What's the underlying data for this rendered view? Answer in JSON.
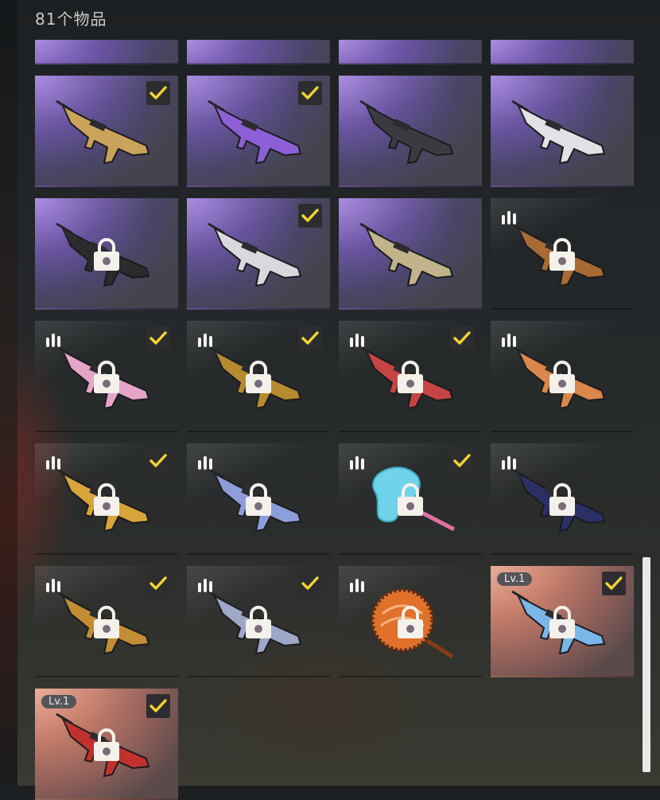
{
  "header": {
    "count_label": "81个物品"
  },
  "colors": {
    "epic": "#6a55a3",
    "legendary": "#a870bc",
    "mythic": "#c87e6b",
    "check": "#f3d431"
  },
  "items": [
    {
      "name": "item-r1c1",
      "rarity": "epic",
      "checked": true,
      "locked": false,
      "icon": "compact-rifle-icon"
    },
    {
      "name": "item-r1c2",
      "rarity": "epic",
      "checked": true,
      "locked": false,
      "icon": "smg-purple-icon"
    },
    {
      "name": "item-r1c3",
      "rarity": "epic",
      "checked": false,
      "locked": false,
      "icon": "rifle-dark-icon"
    },
    {
      "name": "item-r1c4",
      "rarity": "epic",
      "checked": false,
      "locked": false,
      "icon": "rifle-white-icon"
    },
    {
      "name": "item-r2c1",
      "rarity": "epic",
      "checked": false,
      "locked": true,
      "icon": "rifle-black-icon"
    },
    {
      "name": "item-r2c2",
      "rarity": "epic",
      "checked": true,
      "locked": false,
      "icon": "rifle-silver-icon"
    },
    {
      "name": "item-r2c3",
      "rarity": "epic",
      "checked": false,
      "locked": false,
      "icon": "rifle-camo-icon"
    },
    {
      "name": "item-r2c4",
      "rarity": "legendary",
      "checked": false,
      "locked": true,
      "icon": "rifle-bronze-icon"
    },
    {
      "name": "item-r3c1",
      "rarity": "legendary",
      "checked": true,
      "locked": true,
      "icon": "rifle-pink-icon"
    },
    {
      "name": "item-r3c2",
      "rarity": "legendary",
      "checked": true,
      "locked": true,
      "icon": "lmg-gold-icon"
    },
    {
      "name": "item-r3c3",
      "rarity": "legendary",
      "checked": true,
      "locked": true,
      "icon": "rifle-red-icon"
    },
    {
      "name": "item-r3c4",
      "rarity": "legendary",
      "checked": false,
      "locked": true,
      "icon": "rifle-multicolor-icon"
    },
    {
      "name": "item-r4c1",
      "rarity": "legendary",
      "checked": true,
      "locked": true,
      "icon": "rifle-gold-icon"
    },
    {
      "name": "item-r4c2",
      "rarity": "legendary",
      "checked": false,
      "locked": true,
      "icon": "rifle-blue-icon"
    },
    {
      "name": "item-r4c3",
      "rarity": "legendary",
      "checked": true,
      "locked": true,
      "icon": "lollipop-pan-icon"
    },
    {
      "name": "item-r4c4",
      "rarity": "legendary",
      "checked": false,
      "locked": true,
      "icon": "rifle-navy-icon"
    },
    {
      "name": "item-r5c1",
      "rarity": "legendary",
      "checked": true,
      "locked": true,
      "icon": "rifle-gold2-icon"
    },
    {
      "name": "item-r5c2",
      "rarity": "legendary",
      "checked": true,
      "locked": true,
      "icon": "rifle-steel-icon"
    },
    {
      "name": "item-r5c3",
      "rarity": "legendary",
      "checked": false,
      "locked": true,
      "icon": "orange-pan-icon"
    },
    {
      "name": "item-r5c4",
      "rarity": "mythic",
      "checked": true,
      "locked": true,
      "icon": "smg-blue-icon",
      "level": "Lv.1"
    },
    {
      "name": "item-r6c1",
      "rarity": "mythic",
      "checked": true,
      "locked": true,
      "icon": "rifle-crimson-icon",
      "level": "Lv.1"
    }
  ]
}
